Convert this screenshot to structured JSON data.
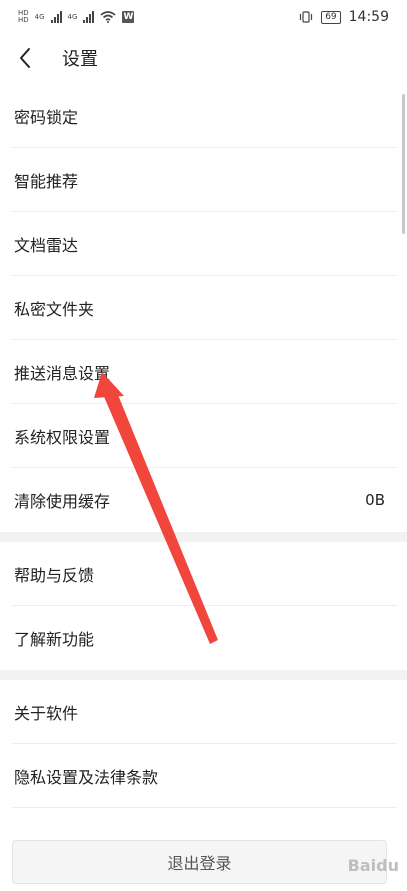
{
  "status_bar": {
    "time": "14:59",
    "battery": "69",
    "net1": "4G",
    "net2": "4G"
  },
  "header": {
    "title": "设置"
  },
  "groups": [
    {
      "items": [
        {
          "label": "密码锁定",
          "value": ""
        },
        {
          "label": "智能推荐",
          "value": ""
        },
        {
          "label": "文档雷达",
          "value": ""
        },
        {
          "label": "私密文件夹",
          "value": ""
        },
        {
          "label": "推送消息设置",
          "value": ""
        },
        {
          "label": "系统权限设置",
          "value": ""
        },
        {
          "label": "清除使用缓存",
          "value": "0B"
        }
      ]
    },
    {
      "items": [
        {
          "label": "帮助与反馈",
          "value": ""
        },
        {
          "label": "了解新功能",
          "value": ""
        }
      ]
    },
    {
      "items": [
        {
          "label": "关于软件",
          "value": ""
        },
        {
          "label": "隐私设置及法律条款",
          "value": ""
        }
      ]
    }
  ],
  "logout": {
    "label": "退出登录"
  },
  "watermark": {
    "text": "Baidu"
  },
  "colors": {
    "annotation_arrow": "#f0463c",
    "section_gap": "#f2f2f2"
  }
}
